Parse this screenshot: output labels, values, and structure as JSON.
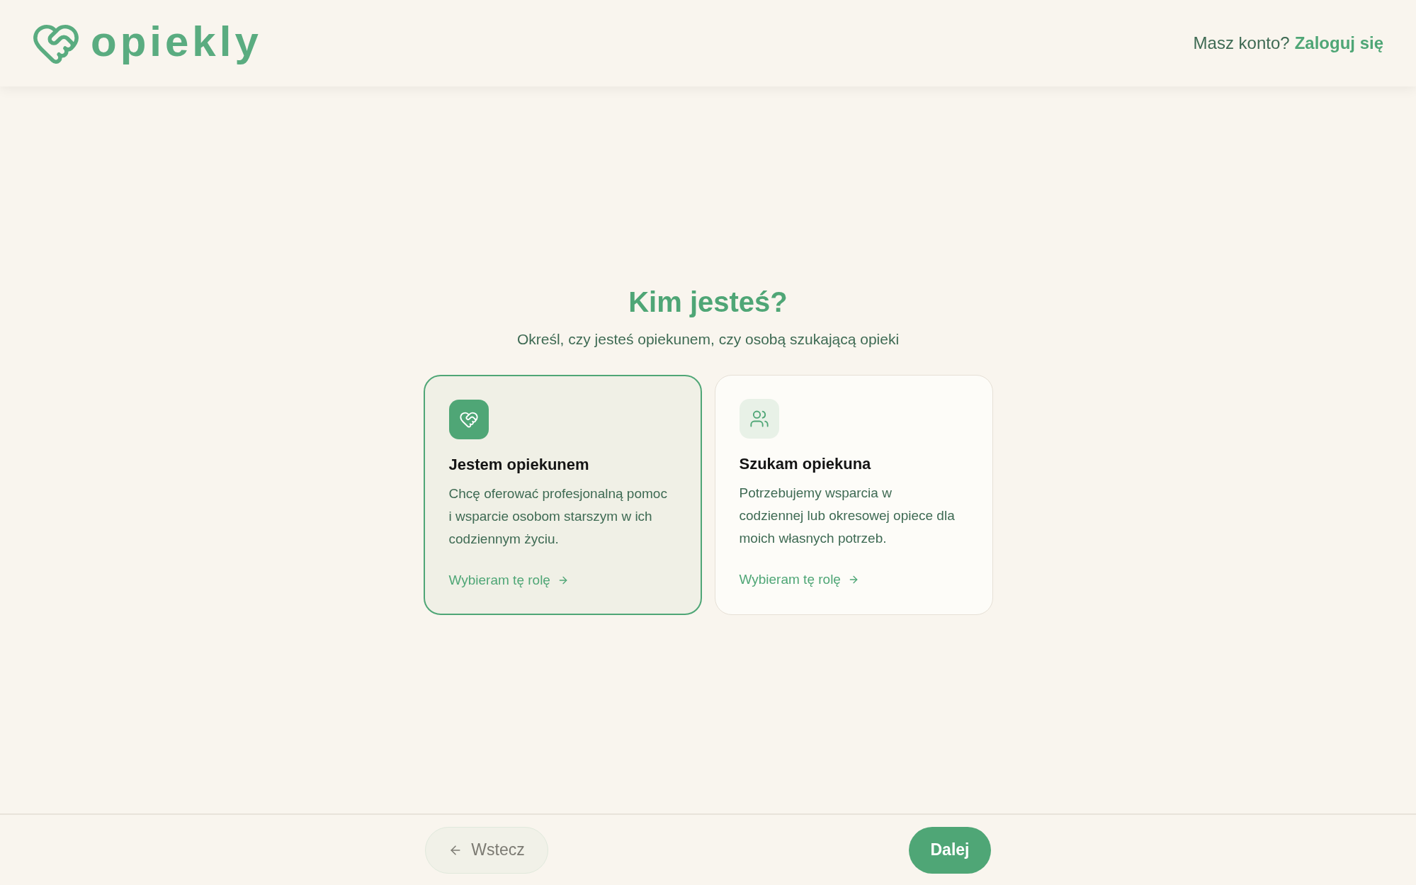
{
  "header": {
    "logo": "opiekly",
    "account_prompt": "Masz konto?",
    "login_link": "Zaloguj się"
  },
  "heading": "Kim jesteś?",
  "subheading": "Określ, czy jesteś opiekunem, czy osobą szukającą opieki",
  "roles": [
    {
      "kind": "caregiver",
      "title": "Jestem opiekunem",
      "description": "Chcę oferować profesjonalną pomoc i wsparcie osobom starszym w ich codziennym życiu.",
      "action": "Wybieram tę rolę",
      "selected": true
    },
    {
      "kind": "seeker",
      "title": "Szukam opiekuna",
      "description": "Potrzebujemy wsparcia w codziennej lub okresowej opiece dla moich własnych potrzeb.",
      "action": "Wybieram tę rolę",
      "selected": false
    }
  ],
  "footer": {
    "back_button": "Wstecz",
    "next_button": "Dalej"
  }
}
